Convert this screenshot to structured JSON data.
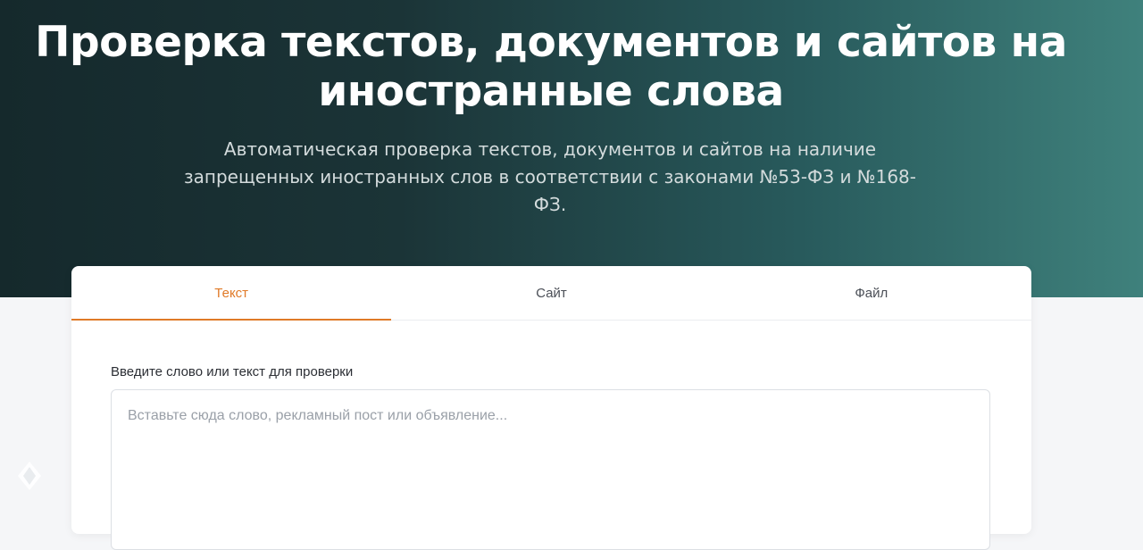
{
  "hero": {
    "title": "Проверка текстов, документов и сайтов на иностранные слова",
    "subtitle": "Автоматическая проверка текстов, документов и сайтов на наличие запрещенных иностранных слов в соответствии с законами №53-ФЗ и №168-ФЗ."
  },
  "tabs": [
    {
      "label": "Текст",
      "active": true
    },
    {
      "label": "Сайт",
      "active": false
    },
    {
      "label": "Файл",
      "active": false
    }
  ],
  "form": {
    "label": "Введите слово или текст для проверки",
    "value": "",
    "placeholder": "Вставьте сюда слово, рекламный пост или объявление..."
  },
  "colors": {
    "accent": "#e07a28",
    "hero_start": "#15292c",
    "hero_end": "#3f817c"
  },
  "icons": {
    "corner": "diamond-logo-icon"
  }
}
